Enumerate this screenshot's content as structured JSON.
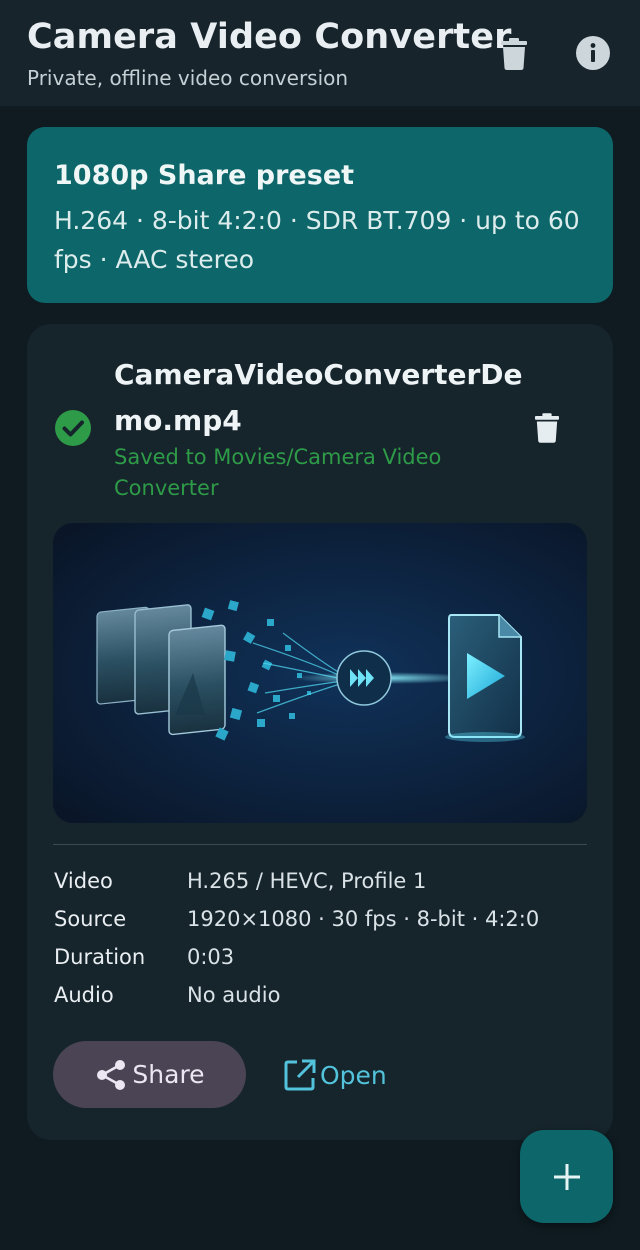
{
  "colors": {
    "background": "#0f1b21",
    "appbar": "#17242b",
    "accent_teal": "#0d6669",
    "success_green": "#2e9b48",
    "link_cyan": "#53c3dc",
    "share_button": "#4a4454"
  },
  "header": {
    "title": "Camera Video Converter",
    "subtitle": "Private, offline video conversion",
    "actions": [
      {
        "icon": "trash-icon"
      },
      {
        "icon": "info-icon"
      }
    ]
  },
  "preset": {
    "title": "1080p Share preset",
    "description": "H.264 · 8-bit 4:2:0 · SDR BT.709 · up to 60 fps · AAC stereo"
  },
  "job": {
    "file_name": "CameraVideoConverterDemo.mp4",
    "status_icon": "check-circle-icon",
    "status_text": "Saved to Movies/Camera Video Converter",
    "delete_icon": "trash-icon",
    "thumbnail_icon": "video-conversion-illustration",
    "details": [
      {
        "label": "Video",
        "value": "H.265 / HEVC, Profile 1"
      },
      {
        "label": "Source",
        "value": "1920×1080 · 30 fps · 8-bit · 4:2:0"
      },
      {
        "label": "Duration",
        "value": "0:03"
      },
      {
        "label": "Audio",
        "value": "No audio"
      }
    ],
    "share_label": "Share",
    "share_icon": "share-icon",
    "open_label": "Open",
    "open_icon": "open-external-icon"
  },
  "fab": {
    "icon": "plus-icon"
  }
}
